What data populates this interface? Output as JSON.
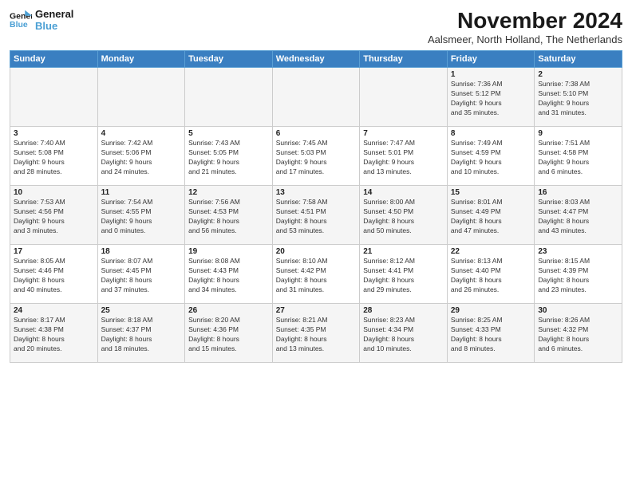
{
  "logo": {
    "line1": "General",
    "line2": "Blue"
  },
  "title": "November 2024",
  "subtitle": "Aalsmeer, North Holland, The Netherlands",
  "days_header": [
    "Sunday",
    "Monday",
    "Tuesday",
    "Wednesday",
    "Thursday",
    "Friday",
    "Saturday"
  ],
  "weeks": [
    [
      {
        "day": "",
        "info": ""
      },
      {
        "day": "",
        "info": ""
      },
      {
        "day": "",
        "info": ""
      },
      {
        "day": "",
        "info": ""
      },
      {
        "day": "",
        "info": ""
      },
      {
        "day": "1",
        "info": "Sunrise: 7:36 AM\nSunset: 5:12 PM\nDaylight: 9 hours\nand 35 minutes."
      },
      {
        "day": "2",
        "info": "Sunrise: 7:38 AM\nSunset: 5:10 PM\nDaylight: 9 hours\nand 31 minutes."
      }
    ],
    [
      {
        "day": "3",
        "info": "Sunrise: 7:40 AM\nSunset: 5:08 PM\nDaylight: 9 hours\nand 28 minutes."
      },
      {
        "day": "4",
        "info": "Sunrise: 7:42 AM\nSunset: 5:06 PM\nDaylight: 9 hours\nand 24 minutes."
      },
      {
        "day": "5",
        "info": "Sunrise: 7:43 AM\nSunset: 5:05 PM\nDaylight: 9 hours\nand 21 minutes."
      },
      {
        "day": "6",
        "info": "Sunrise: 7:45 AM\nSunset: 5:03 PM\nDaylight: 9 hours\nand 17 minutes."
      },
      {
        "day": "7",
        "info": "Sunrise: 7:47 AM\nSunset: 5:01 PM\nDaylight: 9 hours\nand 13 minutes."
      },
      {
        "day": "8",
        "info": "Sunrise: 7:49 AM\nSunset: 4:59 PM\nDaylight: 9 hours\nand 10 minutes."
      },
      {
        "day": "9",
        "info": "Sunrise: 7:51 AM\nSunset: 4:58 PM\nDaylight: 9 hours\nand 6 minutes."
      }
    ],
    [
      {
        "day": "10",
        "info": "Sunrise: 7:53 AM\nSunset: 4:56 PM\nDaylight: 9 hours\nand 3 minutes."
      },
      {
        "day": "11",
        "info": "Sunrise: 7:54 AM\nSunset: 4:55 PM\nDaylight: 9 hours\nand 0 minutes."
      },
      {
        "day": "12",
        "info": "Sunrise: 7:56 AM\nSunset: 4:53 PM\nDaylight: 8 hours\nand 56 minutes."
      },
      {
        "day": "13",
        "info": "Sunrise: 7:58 AM\nSunset: 4:51 PM\nDaylight: 8 hours\nand 53 minutes."
      },
      {
        "day": "14",
        "info": "Sunrise: 8:00 AM\nSunset: 4:50 PM\nDaylight: 8 hours\nand 50 minutes."
      },
      {
        "day": "15",
        "info": "Sunrise: 8:01 AM\nSunset: 4:49 PM\nDaylight: 8 hours\nand 47 minutes."
      },
      {
        "day": "16",
        "info": "Sunrise: 8:03 AM\nSunset: 4:47 PM\nDaylight: 8 hours\nand 43 minutes."
      }
    ],
    [
      {
        "day": "17",
        "info": "Sunrise: 8:05 AM\nSunset: 4:46 PM\nDaylight: 8 hours\nand 40 minutes."
      },
      {
        "day": "18",
        "info": "Sunrise: 8:07 AM\nSunset: 4:45 PM\nDaylight: 8 hours\nand 37 minutes."
      },
      {
        "day": "19",
        "info": "Sunrise: 8:08 AM\nSunset: 4:43 PM\nDaylight: 8 hours\nand 34 minutes."
      },
      {
        "day": "20",
        "info": "Sunrise: 8:10 AM\nSunset: 4:42 PM\nDaylight: 8 hours\nand 31 minutes."
      },
      {
        "day": "21",
        "info": "Sunrise: 8:12 AM\nSunset: 4:41 PM\nDaylight: 8 hours\nand 29 minutes."
      },
      {
        "day": "22",
        "info": "Sunrise: 8:13 AM\nSunset: 4:40 PM\nDaylight: 8 hours\nand 26 minutes."
      },
      {
        "day": "23",
        "info": "Sunrise: 8:15 AM\nSunset: 4:39 PM\nDaylight: 8 hours\nand 23 minutes."
      }
    ],
    [
      {
        "day": "24",
        "info": "Sunrise: 8:17 AM\nSunset: 4:38 PM\nDaylight: 8 hours\nand 20 minutes."
      },
      {
        "day": "25",
        "info": "Sunrise: 8:18 AM\nSunset: 4:37 PM\nDaylight: 8 hours\nand 18 minutes."
      },
      {
        "day": "26",
        "info": "Sunrise: 8:20 AM\nSunset: 4:36 PM\nDaylight: 8 hours\nand 15 minutes."
      },
      {
        "day": "27",
        "info": "Sunrise: 8:21 AM\nSunset: 4:35 PM\nDaylight: 8 hours\nand 13 minutes."
      },
      {
        "day": "28",
        "info": "Sunrise: 8:23 AM\nSunset: 4:34 PM\nDaylight: 8 hours\nand 10 minutes."
      },
      {
        "day": "29",
        "info": "Sunrise: 8:25 AM\nSunset: 4:33 PM\nDaylight: 8 hours\nand 8 minutes."
      },
      {
        "day": "30",
        "info": "Sunrise: 8:26 AM\nSunset: 4:32 PM\nDaylight: 8 hours\nand 6 minutes."
      }
    ]
  ]
}
